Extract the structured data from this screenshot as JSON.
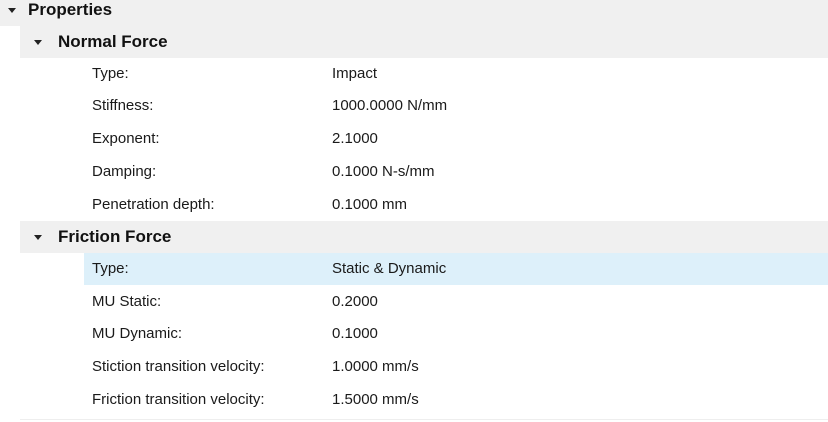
{
  "properties": {
    "title": "Properties",
    "sections": [
      {
        "title": "Normal Force",
        "rows": [
          {
            "label": "Type:",
            "value": "Impact"
          },
          {
            "label": "Stiffness:",
            "value": "1000.0000 N/mm"
          },
          {
            "label": "Exponent:",
            "value": "2.1000"
          },
          {
            "label": "Damping:",
            "value": "0.1000 N-s/mm"
          },
          {
            "label": "Penetration depth:",
            "value": "0.1000 mm"
          }
        ]
      },
      {
        "title": "Friction Force",
        "rows": [
          {
            "label": "Type:",
            "value": "Static & Dynamic"
          },
          {
            "label": "MU Static:",
            "value": "0.2000"
          },
          {
            "label": "MU Dynamic:",
            "value": "0.1000"
          },
          {
            "label": "Stiction transition velocity:",
            "value": "1.0000 mm/s"
          },
          {
            "label": "Friction transition velocity:",
            "value": "1.5000 mm/s"
          }
        ]
      }
    ]
  },
  "selected_row": "Friction Force / Type:",
  "colors": {
    "selection": "#ddf0fa",
    "header_bg": "#f0f0f0"
  },
  "icons": {
    "expander": "collapse-caret-icon"
  }
}
